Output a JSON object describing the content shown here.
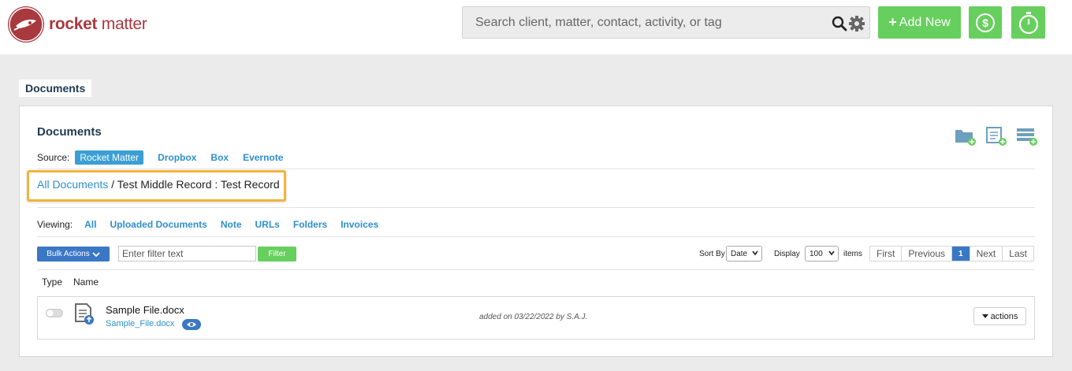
{
  "brand": {
    "name_bold": "rocket",
    "name_light": " matter",
    "color": "#a8393f"
  },
  "header": {
    "search_placeholder": "Search client, matter, contact, activity, or tag",
    "add_new_label": "Add New",
    "accent": "#67cf5e"
  },
  "page_tab": "Documents",
  "panel": {
    "title": "Documents",
    "source": {
      "label": "Source:",
      "active": "Rocket Matter",
      "links": [
        "Dropbox",
        "Box",
        "Evernote"
      ]
    },
    "toolbar_icons": [
      "new-folder-icon",
      "new-document-icon",
      "add-list-icon"
    ],
    "breadcrumb": {
      "link": "All Documents",
      "rest": " / Test Middle Record : Test Record"
    },
    "viewing": {
      "label": "Viewing:",
      "filters": [
        "All",
        "Uploaded Documents",
        "Note",
        "URLs",
        "Folders",
        "Invoices"
      ]
    },
    "controls": {
      "bulk_actions": "Bulk Actions",
      "filter_placeholder": "Enter filter text",
      "filter_button": "Filter",
      "sort_label": "Sort By",
      "sort_value": "Date",
      "display_label": "Display",
      "display_value": "100",
      "items_label": "items"
    },
    "pager": {
      "first": "First",
      "previous": "Previous",
      "current": "1",
      "next": "Next",
      "last": "Last"
    },
    "table": {
      "headers": [
        "Type",
        "Name"
      ],
      "rows": [
        {
          "title": "Sample File.docx",
          "filename": "Sample_File.docx",
          "added": "added on 03/22/2022 by S.A.J.",
          "actions": "actions"
        }
      ]
    }
  }
}
